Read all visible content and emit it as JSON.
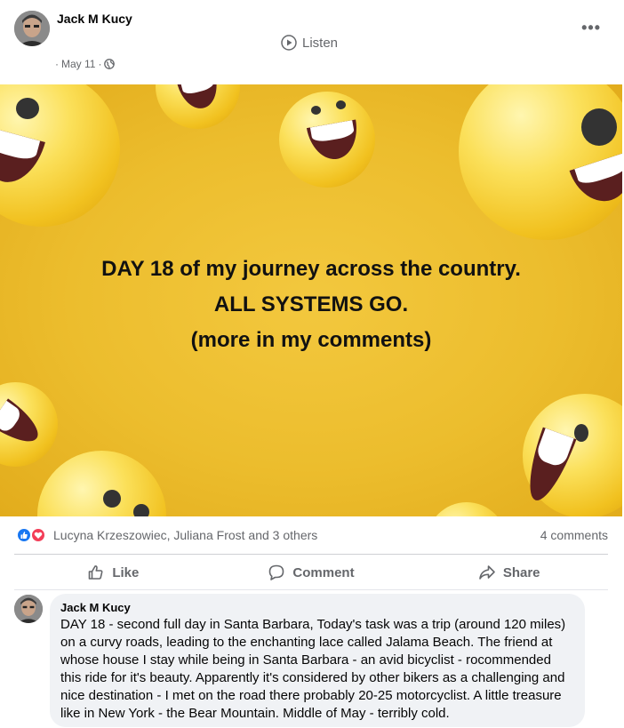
{
  "post": {
    "author": "Jack M Kucy",
    "date": "May 11",
    "date_prefix": "·",
    "date_suffix": "·",
    "listen_label": "Listen",
    "more_label": "•••"
  },
  "banner": {
    "line1": "DAY 18 of my journey across the country.",
    "line2": "ALL SYSTEMS GO.",
    "line3": "(more in my comments)"
  },
  "reactions": {
    "names": "Lucyna Krzeszowiec, Juliana Frost and 3 others",
    "comment_count": "4 comments"
  },
  "actions": {
    "like": "Like",
    "comment": "Comment",
    "share": "Share"
  },
  "comment": {
    "author": "Jack M Kucy",
    "text": "DAY 18 - second full day in Santa Barbara, Today's task was a trip (around 120 miles) on a curvy roads, leading to the enchanting lace called Jalama Beach. The friend at whose house I stay while being in Santa Barbara - an avid bicyclist - rocommended this ride for it's beauty. Apparently it's considered by other bikers as a challenging and nice destination - I met on the road there probably 20-25 motorcyclist. A little treasure like in New York - the Bear Mountain. Middle of May - terribly cold."
  },
  "colors": {
    "banner_yellow": "#ecbd2d",
    "like_blue": "#1877f2",
    "love_red": "#f33e58",
    "secondary_text": "#65676b"
  },
  "icons": [
    "globe-icon",
    "play-circle-icon",
    "more-icon",
    "thumbs-up-icon",
    "comment-icon",
    "share-icon",
    "like-reaction-icon",
    "love-reaction-icon"
  ]
}
